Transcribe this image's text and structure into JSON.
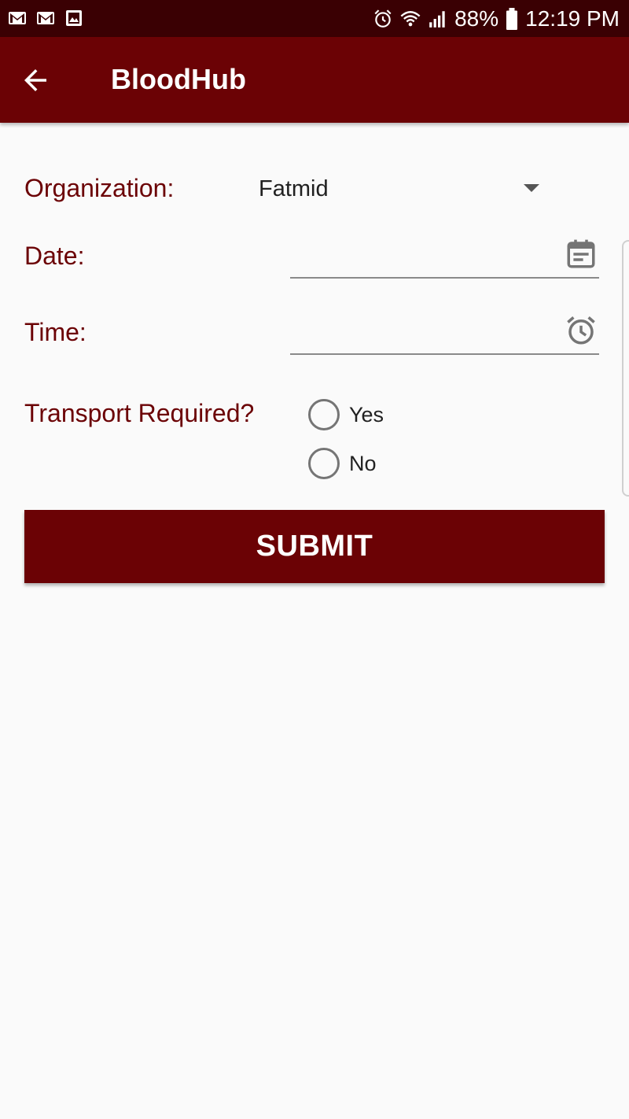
{
  "status_bar": {
    "icons_left": [
      "gmail-icon",
      "gmail-icon",
      "gallery-icon"
    ],
    "icons_right": [
      "alarm-icon",
      "wifi-icon",
      "signal-icon",
      "battery-icon"
    ],
    "battery": "88%",
    "time": "12:19 PM"
  },
  "app_bar": {
    "title": "BloodHub",
    "back_icon": "arrow-back-icon"
  },
  "form": {
    "organization_label": "Organization:",
    "organization_value": "Fatmid",
    "date_label": "Date:",
    "date_value": "",
    "date_icon": "calendar-icon",
    "time_label": "Time:",
    "time_value": "",
    "time_icon": "alarm-clock-icon",
    "transport_label": "Transport Required?",
    "transport_options": [
      "Yes",
      "No"
    ],
    "transport_selected": null
  },
  "submit_label": "SUBMIT",
  "colors": {
    "primary": "#6b0205",
    "status_bar": "#3a0003",
    "label": "#6b0205",
    "background": "#fafafa"
  }
}
